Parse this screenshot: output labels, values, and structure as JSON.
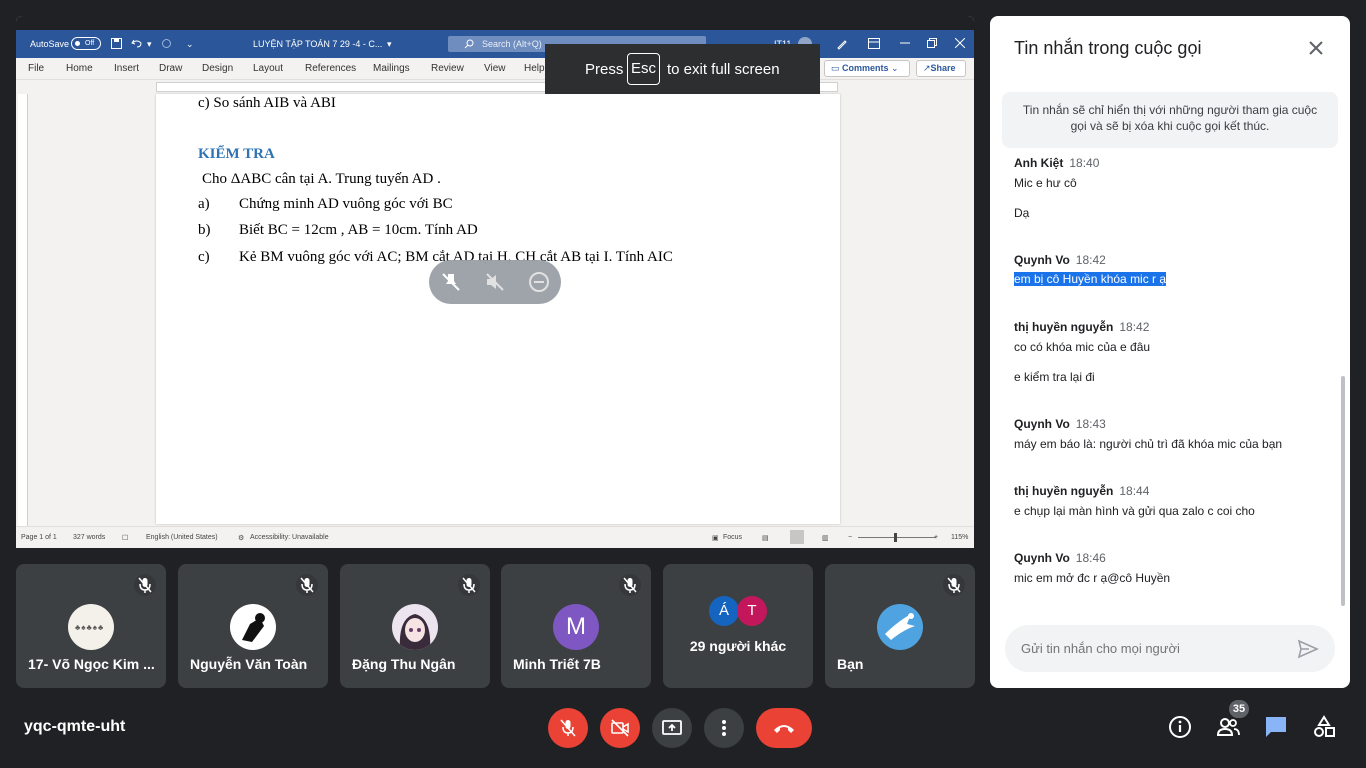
{
  "word": {
    "autosave_label": "AutoSave",
    "autosave_state": "Off",
    "doc_title": "LUYỆN TẬP TOÁN 7 29 -4  -  C...",
    "search_placeholder": "Search (Alt+Q)",
    "user_initials": "IT11",
    "tabs": [
      "File",
      "Home",
      "Insert",
      "Draw",
      "Design",
      "Layout",
      "References",
      "Mailings",
      "Review",
      "View",
      "Help"
    ],
    "comments_label": "Comments",
    "share_label": "Share",
    "document": {
      "line_prev": "c) So sánh  AIB  và  ABI",
      "heading": "KIỂM TRA",
      "intro": "Cho ΔABC cân tại A. Trung tuyến AD .",
      "items": [
        {
          "marker": "a)",
          "text": "Chứng minh AD vuông góc với BC"
        },
        {
          "marker": "b)",
          "text": "Biết BC = 12cm , AB = 10cm. Tính AD"
        },
        {
          "marker": "c)",
          "text": "Kẻ BM vuông góc với AC; BM cắt AD tại H, CH cắt AB tại I. Tính  AIC"
        }
      ]
    },
    "status": {
      "page": "Page 1 of 1",
      "words": "327 words",
      "language": "English (United States)",
      "accessibility": "Accessibility: Unavailable",
      "focus": "Focus",
      "zoom": "115%"
    }
  },
  "fullscreen_notice": {
    "press": "Press",
    "key": "Esc",
    "rest": "to exit full screen"
  },
  "participants": [
    {
      "name": "17- Võ Ngọc Kim ...",
      "avatar_type": "image"
    },
    {
      "name": "Nguyễn Văn Toàn",
      "avatar_type": "image"
    },
    {
      "name": "Đặng Thu Ngân",
      "avatar_type": "image"
    },
    {
      "name": "Minh Triết 7B",
      "avatar_letter": "M",
      "avatar_color": "#7e57c2"
    },
    {
      "name": "29 người khác",
      "avatars": [
        "Á",
        "T"
      ],
      "avatar_colors": [
        "#1565c0",
        "#c2185b"
      ]
    },
    {
      "name": "Bạn",
      "avatar_type": "image"
    }
  ],
  "chat": {
    "title": "Tin nhắn trong cuộc gọi",
    "notice": "Tin nhắn sẽ chỉ hiển thị với những người tham gia cuộc gọi và sẽ bị xóa khi cuộc gọi kết thúc.",
    "messages": [
      {
        "sender": "Anh Kiệt",
        "time": "18:40",
        "lines": [
          "Mic e hư cô",
          "Dạ"
        ]
      },
      {
        "sender": "Quynh Vo",
        "time": "18:42",
        "lines": [
          "em bị cô Huyền khóa mic r ạ"
        ]
      },
      {
        "sender": "thị huyền nguyễn",
        "time": "18:42",
        "lines": [
          "co có khóa mic của e đâu",
          "e kiểm tra lại đi"
        ]
      },
      {
        "sender": "Quynh Vo",
        "time": "18:43",
        "lines": [
          "máy em báo là: người chủ trì đã khóa mic của bạn"
        ]
      },
      {
        "sender": "thị huyền nguyễn",
        "time": "18:44",
        "lines": [
          "e chụp lại màn hình và gửi qua zalo c coi cho"
        ]
      },
      {
        "sender": "Quynh Vo",
        "time": "18:46",
        "lines": [
          "mic em mở đc r ạ@cô Huyền"
        ]
      }
    ],
    "input_placeholder": "Gửi tin nhắn cho mọi người"
  },
  "meeting_code": "yqc-qmte-uht",
  "people_count": "35",
  "colors": {
    "end_call": "#ea4335",
    "muted": "#ea4335",
    "chat_active": "#8ab4f8",
    "word_blue": "#2b579a"
  }
}
